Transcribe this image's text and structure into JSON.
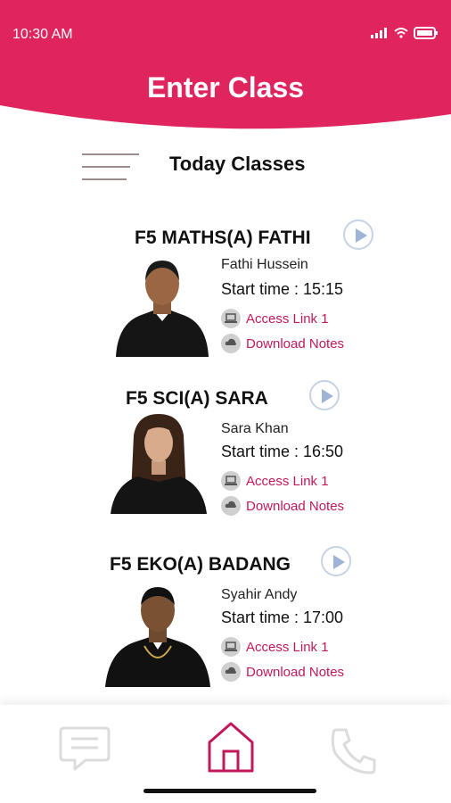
{
  "status": {
    "time": "10:30 AM"
  },
  "header": {
    "title": "Enter Class",
    "color": "#e0245e"
  },
  "section": {
    "title": "Today Classes"
  },
  "classes": [
    {
      "title": "F5 MATHS(A) FATHI",
      "teacher": "Fathi Hussein",
      "start": "Start time : 15:15",
      "access": "Access Link 1",
      "notes": "Download Notes"
    },
    {
      "title": "F5 SCI(A) SARA",
      "teacher": "Sara Khan",
      "start": "Start time : 16:50",
      "access": "Access Link 1",
      "notes": "Download Notes"
    },
    {
      "title": "F5 EKO(A) BADANG",
      "teacher": "Syahir Andy",
      "start": "Start time : 17:00",
      "access": "Access Link 1",
      "notes": "Download Notes"
    }
  ],
  "nav": {
    "items": [
      "chat-icon",
      "home-icon",
      "phone-icon"
    ],
    "active": "home-icon",
    "active_color": "#c2185b"
  },
  "link_color": "#c2185b"
}
